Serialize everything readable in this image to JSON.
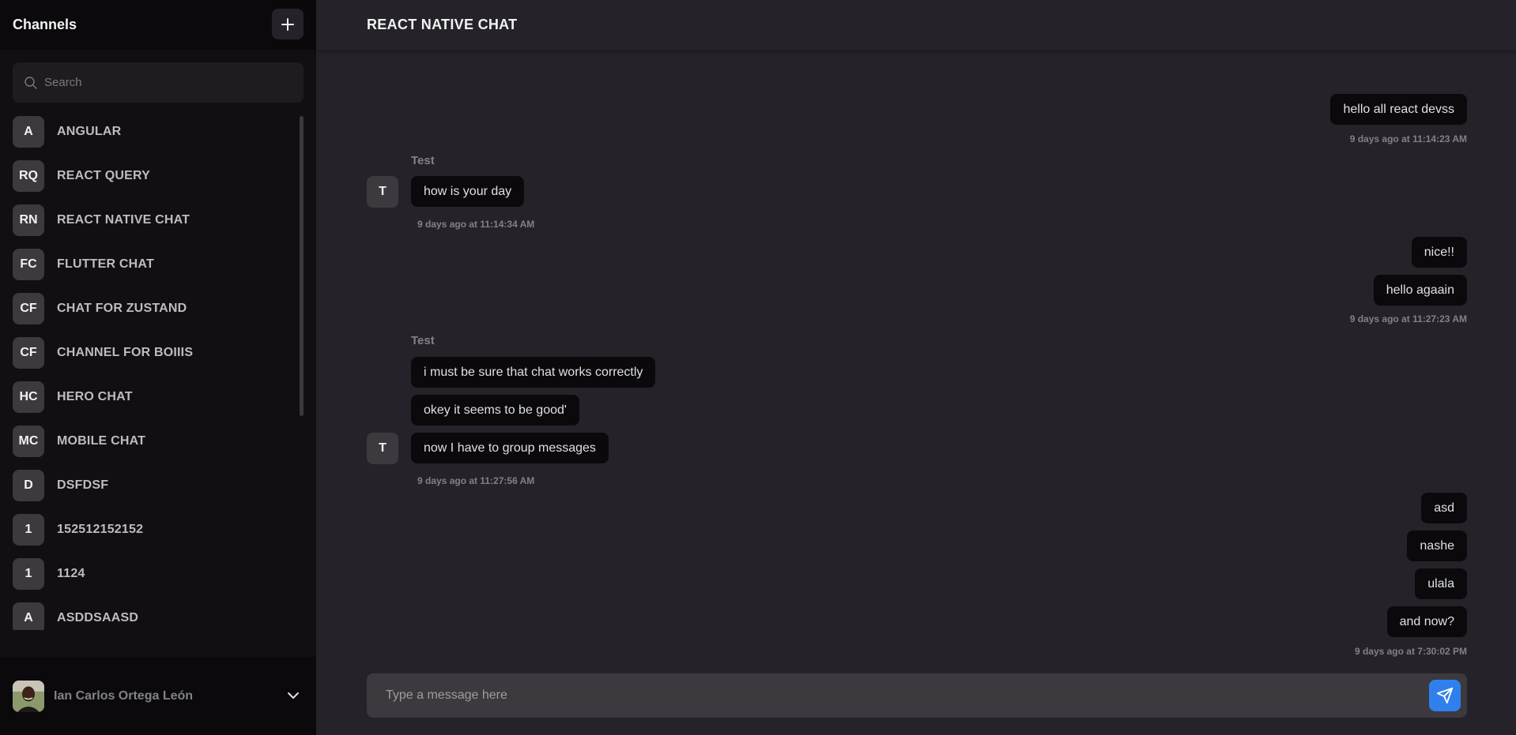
{
  "sidebar": {
    "title": "Channels",
    "search_placeholder": "Search",
    "channels": [
      {
        "initials": "A",
        "name": "ANGULAR"
      },
      {
        "initials": "RQ",
        "name": "REACT QUERY"
      },
      {
        "initials": "RN",
        "name": "REACT NATIVE CHAT"
      },
      {
        "initials": "FC",
        "name": "FLUTTER CHAT"
      },
      {
        "initials": "CF",
        "name": "CHAT FOR ZUSTAND"
      },
      {
        "initials": "CF",
        "name": "CHANNEL FOR BOIIIS"
      },
      {
        "initials": "HC",
        "name": "HERO CHAT"
      },
      {
        "initials": "MC",
        "name": "MOBILE CHAT"
      },
      {
        "initials": "D",
        "name": "DSFDSF"
      },
      {
        "initials": "1",
        "name": "152512152152"
      },
      {
        "initials": "1",
        "name": "1124"
      },
      {
        "initials": "A",
        "name": "ASDDSAASD"
      }
    ],
    "user": {
      "name": "Ian Carlos Ortega León"
    }
  },
  "main": {
    "channel_title": "REACT NATIVE CHAT",
    "messages": {
      "g1": {
        "texts": [
          "hello all react devss"
        ],
        "time": "9 days ago at 11:14:23 AM"
      },
      "g2": {
        "sender": "Test",
        "initial": "T",
        "texts": [
          "how is your day"
        ],
        "time": "9 days ago at 11:14:34 AM"
      },
      "g3": {
        "texts": [
          "nice!!",
          "hello agaain"
        ],
        "time": "9 days ago at 11:27:23 AM"
      },
      "g4": {
        "sender": "Test",
        "initial": "T",
        "texts": [
          "i must be sure that chat works correctly",
          "okey it seems to be good'",
          "now I have to group messages"
        ],
        "time": "9 days ago at 11:27:56 AM"
      },
      "g5": {
        "texts": [
          "asd",
          "nashe",
          "ulala",
          "and now?"
        ],
        "time": "9 days ago at 7:30:02 PM"
      }
    },
    "composer": {
      "placeholder": "Type a message here"
    }
  },
  "colors": {
    "sidebar_bg": "#120f13",
    "main_bg": "#252329",
    "bubble_bg": "#0b090c",
    "accent": "#2f80ed",
    "muted_text": "#828282"
  }
}
